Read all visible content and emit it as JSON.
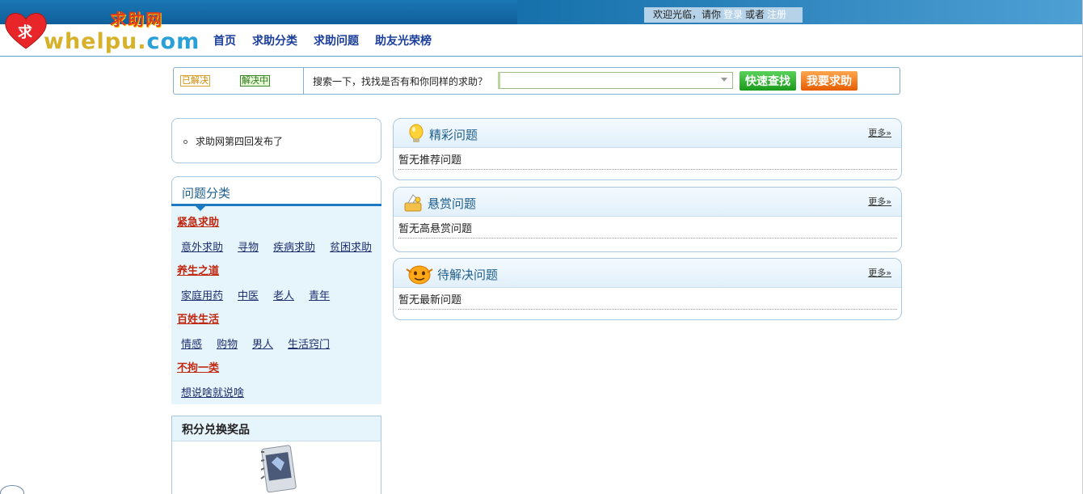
{
  "header": {
    "logo_heart_char": "求",
    "logo_cn": "求助网",
    "logo_en_part1": "whelpu.",
    "logo_en_part2": "com",
    "welcome_text": "欢迎光临，请你",
    "login_label": "登录",
    "or_text": "或者",
    "register_label": "注册",
    "nav": [
      "首页",
      "求助分类",
      "求助问题",
      "助友光荣榜"
    ]
  },
  "search": {
    "tag_solved": "已解决",
    "tag_solving": "解决中",
    "prompt": "搜索一下，找找是否有和你同样的求助？",
    "input_value": "",
    "find_button": "快速查找",
    "ask_button": "我要求助"
  },
  "notice": {
    "item": "求助网第四回发布了"
  },
  "categories": {
    "title": "问题分类",
    "groups": [
      {
        "name": "紧急求助",
        "subs": [
          "意外求助",
          "寻物",
          "疾病求助",
          "贫困求助"
        ]
      },
      {
        "name": "养生之道",
        "subs": [
          "家庭用药",
          "中医",
          "老人",
          "青年"
        ]
      },
      {
        "name": "百姓生活",
        "subs": [
          "情感",
          "购物",
          "男人",
          "生活窍门"
        ]
      },
      {
        "name": "不拘一类",
        "subs": [
          "想说啥就说啥"
        ]
      }
    ]
  },
  "prize": {
    "title": "积分兑换奖品"
  },
  "questions": [
    {
      "title": "精彩问题",
      "more": "更多»",
      "empty": "暂无推荐问题",
      "icon": "lightbulb-icon"
    },
    {
      "title": "悬赏问题",
      "more": "更多»",
      "empty": "暂无高悬赏问题",
      "icon": "reward-icon"
    },
    {
      "title": "待解决问题",
      "more": "更多»",
      "empty": "暂无最新问题",
      "icon": "smiley-icon"
    }
  ],
  "colors": {
    "topbar": "#1b77b5",
    "nav_link": "#1b3f9a",
    "category_red": "#c0270f",
    "panel_border": "#a9c8df",
    "panel_bg": "#e6f4fc",
    "find_button": "#1a9a1a",
    "ask_button": "#e65c00"
  }
}
